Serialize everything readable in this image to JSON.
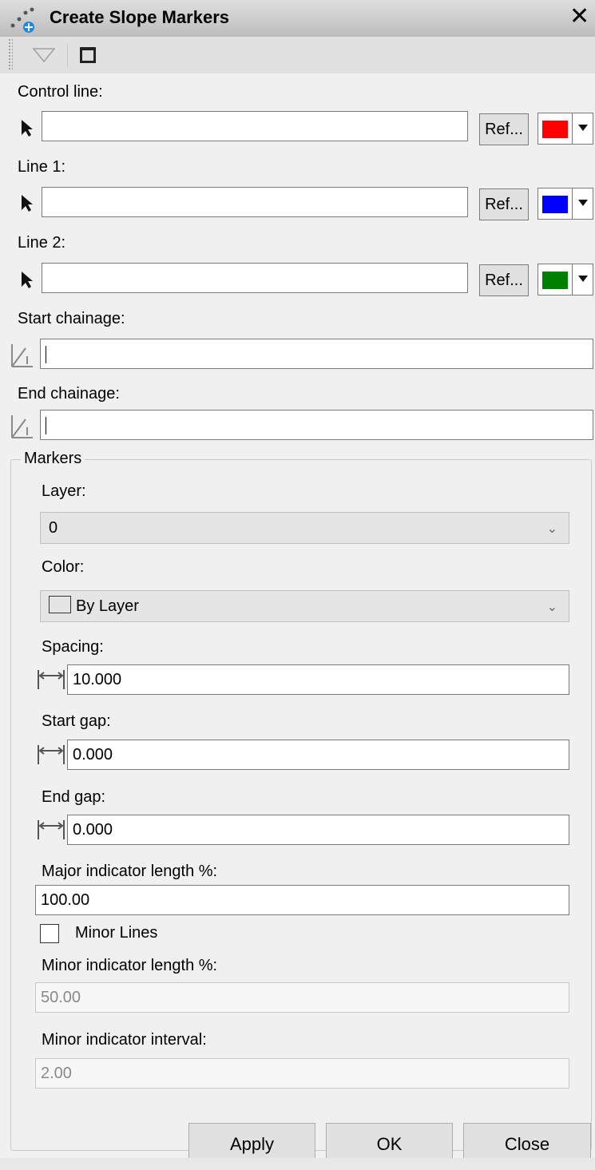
{
  "window": {
    "title": "Create Slope Markers",
    "close_glyph": "✕"
  },
  "toolbar": {
    "filter_icon": "filter-icon",
    "panel_icon": "panel-icon"
  },
  "control_line": {
    "label": "Control line:",
    "value": "",
    "ref_label": "Ref...",
    "color": "#ff0000"
  },
  "line1": {
    "label": "Line 1:",
    "value": "",
    "ref_label": "Ref...",
    "color": "#0000ff"
  },
  "line2": {
    "label": "Line 2:",
    "value": "",
    "ref_label": "Ref...",
    "color": "#008000"
  },
  "start_chainage": {
    "label": "Start chainage:",
    "value": ""
  },
  "end_chainage": {
    "label": "End chainage:",
    "value": ""
  },
  "markers": {
    "title": "Markers",
    "layer": {
      "label": "Layer:",
      "value": "0"
    },
    "color": {
      "label": "Color:",
      "value": "By Layer"
    },
    "spacing": {
      "label": "Spacing:",
      "value": "10.000"
    },
    "start_gap": {
      "label": "Start gap:",
      "value": "0.000"
    },
    "end_gap": {
      "label": "End gap:",
      "value": "0.000"
    },
    "major_length": {
      "label": "Major indicator length %:",
      "value": "100.00"
    },
    "minor_lines": {
      "label": "Minor Lines",
      "checked": false
    },
    "minor_length": {
      "label": "Minor indicator length %:",
      "value": "50.00"
    },
    "minor_interval": {
      "label": "Minor indicator interval:",
      "value": "2.00"
    }
  },
  "buttons": {
    "apply": "Apply",
    "ok": "OK",
    "close": "Close"
  }
}
